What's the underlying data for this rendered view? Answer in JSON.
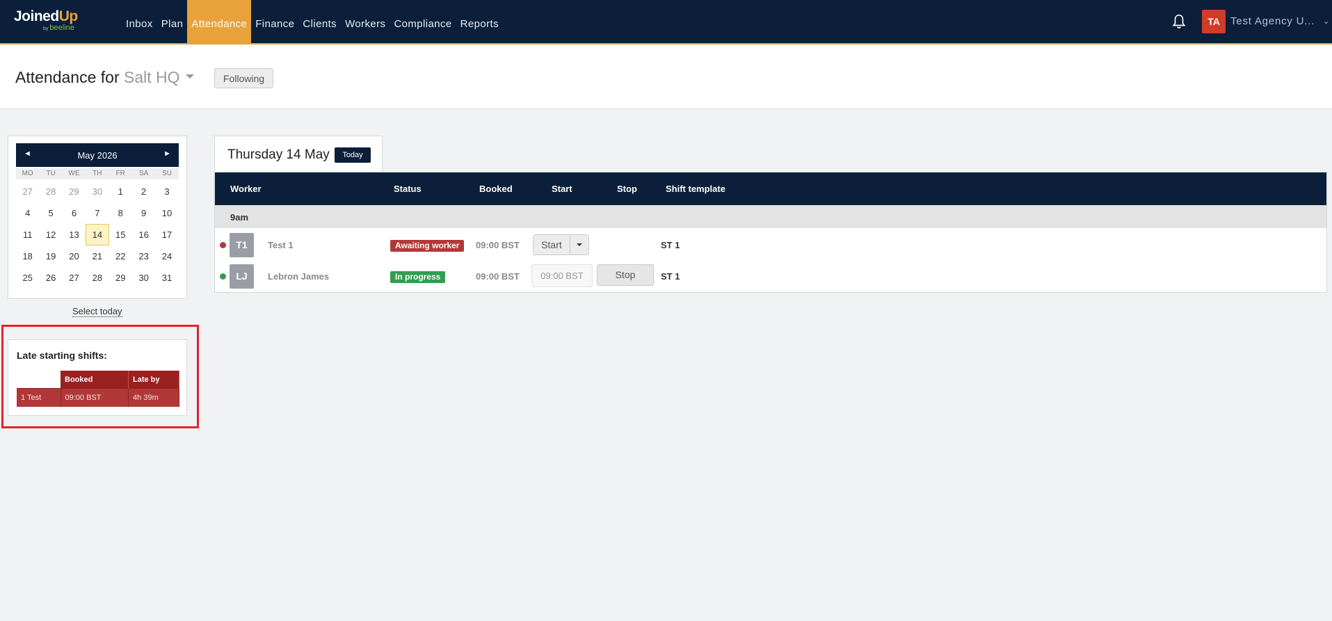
{
  "brand": {
    "name_a": "Joined",
    "name_b": "Up",
    "by": "by",
    "partner": "beeline"
  },
  "nav": [
    {
      "label": "Inbox",
      "active": false
    },
    {
      "label": "Plan",
      "active": false
    },
    {
      "label": "Attendance",
      "active": true
    },
    {
      "label": "Finance",
      "active": false
    },
    {
      "label": "Clients",
      "active": false
    },
    {
      "label": "Workers",
      "active": false
    },
    {
      "label": "Compliance",
      "active": false
    },
    {
      "label": "Reports",
      "active": false
    }
  ],
  "user": {
    "initials": "TA",
    "name": "Test Agency U..."
  },
  "header": {
    "title_prefix": "Attendance for",
    "site": "Salt HQ",
    "following_label": "Following"
  },
  "calendar": {
    "prev": "◄",
    "next": "►",
    "month": "May 2026",
    "dows": [
      "MO",
      "TU",
      "WE",
      "TH",
      "FR",
      "SA",
      "SU"
    ],
    "weeks": [
      [
        "27",
        "28",
        "29",
        "30",
        "1",
        "2",
        "3"
      ],
      [
        "4",
        "5",
        "6",
        "7",
        "8",
        "9",
        "10"
      ],
      [
        "11",
        "12",
        "13",
        "14",
        "15",
        "16",
        "17"
      ],
      [
        "18",
        "19",
        "20",
        "21",
        "22",
        "23",
        "24"
      ],
      [
        "25",
        "26",
        "27",
        "28",
        "29",
        "30",
        "31"
      ]
    ],
    "selected_day": "14",
    "select_today_label": "Select today"
  },
  "late": {
    "title": "Late starting shifts:",
    "headers": [
      "",
      "Booked",
      "Late by"
    ],
    "rows": [
      {
        "worker": "1 Test",
        "booked": "09:00 BST",
        "late_by": "4h 39m"
      }
    ]
  },
  "day": {
    "title": "Thursday 14 May",
    "today_label": "Today"
  },
  "table": {
    "headers": {
      "worker": "Worker",
      "status": "Status",
      "booked": "Booked",
      "start": "Start",
      "stop": "Stop",
      "template": "Shift template"
    },
    "group": "9am",
    "rows": [
      {
        "initials": "T1",
        "name": "Test 1",
        "status": "Awaiting worker",
        "booked": "09:00 BST",
        "start_label": "Start",
        "template": "ST 1"
      },
      {
        "initials": "LJ",
        "name": "Lebron James",
        "status": "In progress",
        "booked": "09:00 BST",
        "start_time": "09:00 BST",
        "stop_label": "Stop",
        "template": "ST 1"
      }
    ]
  },
  "colors": {
    "navy": "#0b1f3a",
    "accent": "#e9a23b",
    "danger": "#b23838",
    "success": "#2f9e4f"
  }
}
